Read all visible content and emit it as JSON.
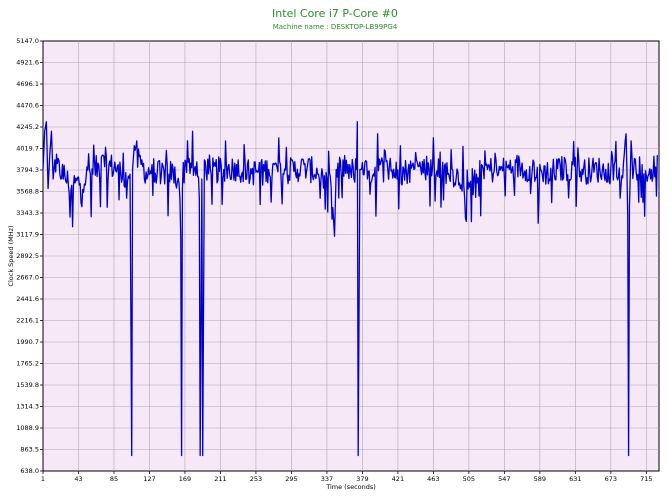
{
  "chart_data": {
    "type": "line",
    "title": "Intel Core i7 P-Core #0",
    "subtitle": "Machine name : DESKTOP-LB99PG4",
    "xlabel": "Time (seconds)",
    "ylabel": "Clock Speed (MHz)",
    "xlim": [
      1,
      730
    ],
    "ylim": [
      638.0,
      5147.0
    ],
    "grid": true,
    "x_ticks": [
      "1",
      "43",
      "85",
      "127",
      "169",
      "211",
      "253",
      "295",
      "337",
      "379",
      "421",
      "463",
      "505",
      "547",
      "589",
      "631",
      "673",
      "715"
    ],
    "y_ticks": [
      "5147.0",
      "4921.6",
      "4696.1",
      "4470.6",
      "4245.2",
      "4019.7",
      "3794.3",
      "3568.8",
      "3343.3",
      "3117.9",
      "2892.5",
      "2667.0",
      "2441.6",
      "2216.1",
      "1990.7",
      "1765.2",
      "1539.8",
      "1314.3",
      "1088.9",
      "863.5",
      "638.0"
    ],
    "series": [
      {
        "color": "#0000cc",
        "baseline": 3800,
        "x": [
          1,
          3,
          5,
          7,
          9,
          11,
          13,
          15,
          25,
          33,
          46,
          60,
          72,
          90,
          100,
          104,
          106,
          107,
          109,
          112,
          118,
          124,
          130,
          140,
          150,
          163,
          164,
          165,
          166,
          172,
          180,
          186,
          187,
          189,
          190,
          192,
          200,
          215,
          230,
          246,
          268,
          290,
          310,
          330,
          344,
          346,
          348,
          356,
          364,
          369,
          372,
          373,
          374,
          376,
          378,
          385,
          400,
          420,
          440,
          460,
          480,
          500,
          520,
          540,
          560,
          580,
          600,
          620,
          640,
          660,
          672,
          684,
          690,
          693,
          694,
          695,
          697,
          700,
          705,
          710,
          720,
          728
        ],
        "y": [
          3800,
          4200,
          4300,
          3600,
          3950,
          4200,
          3700,
          3900,
          3700,
          3300,
          3450,
          3750,
          3950,
          3850,
          3500,
          3750,
          800,
          3800,
          4050,
          4100,
          3900,
          3700,
          3850,
          3650,
          3750,
          3500,
          3100,
          800,
          3600,
          4100,
          3800,
          3500,
          800,
          3700,
          800,
          3900,
          3750,
          3800,
          3850,
          3700,
          3800,
          3750,
          3850,
          3700,
          3400,
          3100,
          3800,
          3900,
          3850,
          3700,
          3800,
          4300,
          800,
          3800,
          3800,
          3700,
          3850,
          3700,
          3800,
          3900,
          3750,
          3500,
          3850,
          3750,
          3900,
          3800,
          3700,
          3850,
          3750,
          3800,
          3650,
          3500,
          4100,
          3300,
          800,
          3400,
          4100,
          3800,
          3750,
          3850,
          3700,
          3950
        ]
      }
    ]
  }
}
